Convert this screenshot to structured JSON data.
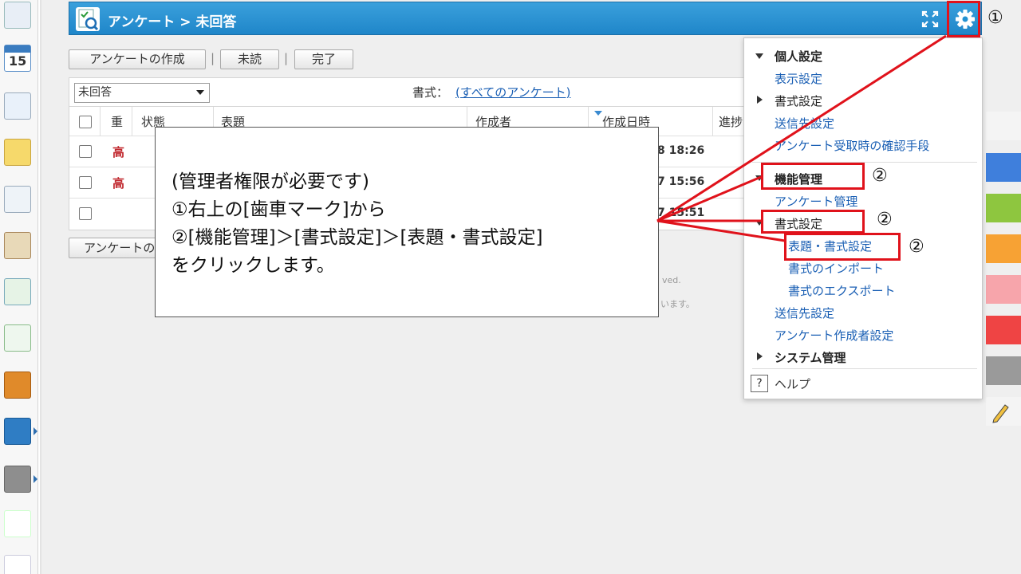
{
  "header": {
    "title": "アンケート > 未回答"
  },
  "toolbar": {
    "create_label": "アンケートの作成",
    "unread_label": "未読",
    "done_label": "完了",
    "separator": "|"
  },
  "filter": {
    "status_value": "未回答",
    "format_label": "書式：",
    "format_link": "(すべてのアンケート)"
  },
  "table": {
    "headers": [
      "重",
      "状態",
      "表題",
      "作成者",
      "作成日時",
      "進捗"
    ],
    "rows": [
      {
        "priority": "高",
        "date": "8 18:26"
      },
      {
        "priority": "高",
        "date": "7 15:56"
      },
      {
        "priority": "",
        "date": "7 15:51"
      }
    ],
    "create_button_partial": "アンケートの",
    "faint_1": "ved.",
    "faint_2": "います。"
  },
  "callout": {
    "lines": [
      "(管理者権限が必要です)",
      "①右上の[歯車マーク]から",
      "②[機能管理]＞[書式設定]＞[表題・書式設定]",
      "をクリックします。"
    ]
  },
  "menu": {
    "personal": "個人設定",
    "display": "表示設定",
    "format_personal": "書式設定",
    "recipients": "送信先設定",
    "receipt_confirm": "アンケート受取時の確認手段",
    "feature_admin": "機能管理",
    "survey_admin": "アンケート管理",
    "format_admin": "書式設定",
    "title_format": "表題・書式設定",
    "format_import": "書式のインポート",
    "format_export": "書式のエクスポート",
    "recipients_admin": "送信先設定",
    "creator_settings": "アンケート作成者設定",
    "system_admin": "システム管理",
    "help_icon": "?",
    "help": "ヘルプ"
  },
  "annotations": {
    "mark_1": "①",
    "mark_2": "②",
    "accent": "#e0121b"
  },
  "colors": {
    "header": "#2391d2",
    "link": "#1a5fb4",
    "priority": "#c0272d"
  }
}
